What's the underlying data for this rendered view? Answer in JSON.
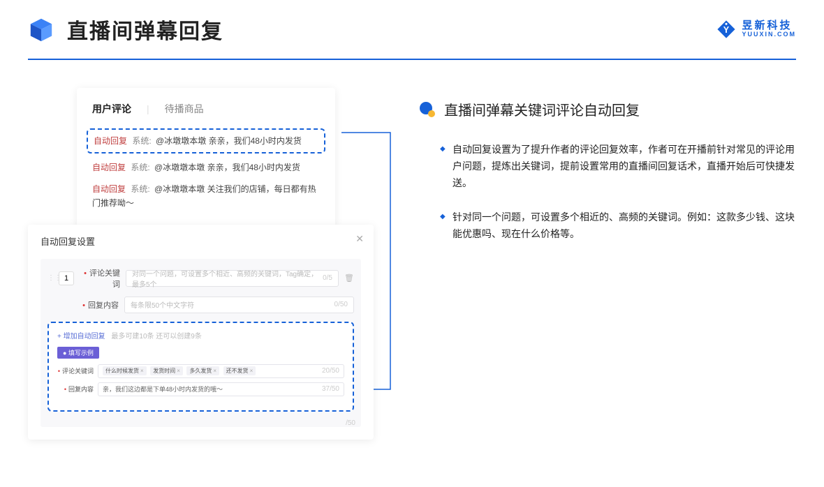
{
  "header": {
    "title": "直播间弹幕回复"
  },
  "brand": {
    "cn": "昱新科技",
    "en": "YUUXIN.COM"
  },
  "card1": {
    "tab_active": "用户评论",
    "tab_other": "待播商品",
    "row1_tag": "自动回复",
    "row1_sys": "系统:",
    "row1_text": "@冰墩墩本墩 亲亲，我们48小时内发货",
    "row2_tag": "自动回复",
    "row2_sys": "系统:",
    "row2_text": "@冰墩墩本墩 亲亲，我们48小时内发货",
    "row3_tag": "自动回复",
    "row3_sys": "系统:",
    "row3_text": "@冰墩墩本墩 关注我们的店铺，每日都有热门推荐呦～"
  },
  "card2": {
    "title": "自动回复设置",
    "idx": "1",
    "label_keyword": "评论关键词",
    "placeholder_keyword": "对同一个问题，可设置多个相近、高频的关键词，Tag确定，最多5个",
    "count_keyword": "0/5",
    "label_content": "回复内容",
    "placeholder_content": "每条限50个中文字符",
    "count_content": "0/50",
    "add_link": "+ 增加自动回复",
    "add_hint": "最多可建10条 还可以创建9条",
    "example_badge": "● 填写示例",
    "ex_label_keyword": "评论关键词",
    "ex_tag1": "什么时候发货",
    "ex_tag2": "发货时间",
    "ex_tag3": "多久发货",
    "ex_tag4": "还不发货",
    "ex_count_keyword": "20/50",
    "ex_label_content": "回复内容",
    "ex_content_text": "亲，我们这边都是下单48小时内发货的哦～",
    "ex_count_content": "37/50",
    "outer_count": "/50"
  },
  "right": {
    "section_title": "直播间弹幕关键词评论自动回复",
    "b1": "自动回复设置为了提升作者的评论回复效率，作者可在开播前针对常见的评论用户问题，提炼出关键词，提前设置常用的直播间回复话术，直播开始后可快捷发送。",
    "b2": "针对同一个问题，可设置多个相近的、高频的关键词。例如：这款多少钱、这块能优惠吗、现在什么价格等。"
  }
}
